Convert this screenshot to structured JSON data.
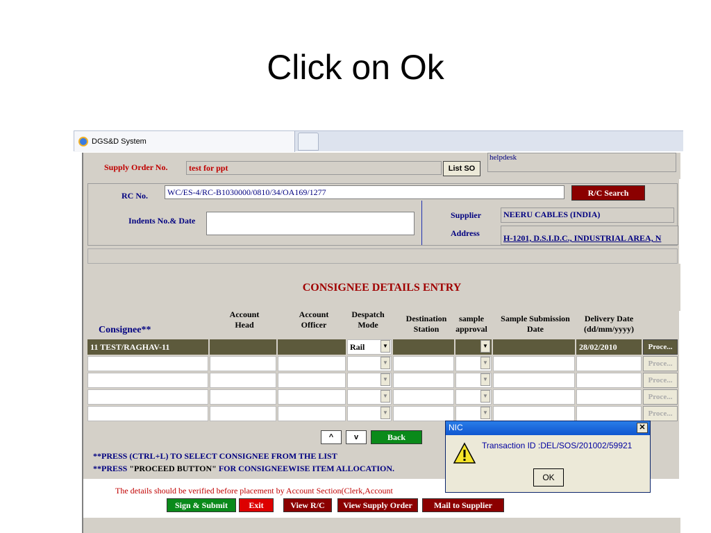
{
  "slide": {
    "title": "Click on Ok"
  },
  "browser": {
    "tab_title": "DGS&D System"
  },
  "top": {
    "supply_order_label": "Supply Order No.",
    "supply_order_value": "test for ppt",
    "list_so_button": "List SO",
    "helpdesk": "helpdesk"
  },
  "rc": {
    "rc_label": "RC No.",
    "rc_value": "WC/ES-4/RC-B1030000/0810/34/OA169/1277",
    "rc_search_button": "R/C Search",
    "indents_label": "Indents No.& Date",
    "indents_value": "",
    "supplier_label": "Supplier",
    "supplier_value": "NEERU CABLES (INDIA)",
    "address_label": "Address",
    "address_value": "H-1201, D.S.I.D.C., INDUSTRIAL AREA, N"
  },
  "section": {
    "heading": "CONSIGNEE DETAILS ENTRY"
  },
  "grid": {
    "headers": {
      "consignee": "Consignee**",
      "account_head_1": "Account",
      "account_head_2": "Head",
      "account_officer_1": "Account",
      "account_officer_2": "Officer",
      "despatch_1": "Despatch",
      "despatch_2": "Mode",
      "destination_1": "Destination",
      "destination_2": "Station",
      "sample_1": "sample",
      "sample_2": "approval",
      "submission_1": "Sample Submission",
      "submission_2": "Date",
      "delivery_1": "Delivery Date",
      "delivery_2": "(dd/mm/yyyy)"
    },
    "rows": [
      {
        "consignee": "11    TEST/RAGHAV-11",
        "despatch": "Rail",
        "delivery": "28/02/2010",
        "proceed": "Proce..."
      },
      {
        "consignee": "",
        "despatch": "",
        "delivery": "",
        "proceed": "Proce..."
      },
      {
        "consignee": "",
        "despatch": "",
        "delivery": "",
        "proceed": "Proce..."
      },
      {
        "consignee": "",
        "despatch": "",
        "delivery": "",
        "proceed": "Proce..."
      },
      {
        "consignee": "",
        "despatch": "",
        "delivery": "",
        "proceed": "Proce..."
      }
    ]
  },
  "nav": {
    "up": "^",
    "down": "v",
    "back": "Back"
  },
  "notes": {
    "line1": "**PRESS (CTRL+L) TO SELECT CONSIGNEE FROM THE LIST",
    "line2_a": "**PRESS ",
    "line2_b": "\"PROCEED BUTTON\"",
    "line2_c": " FOR CONSIGNEEWISE ITEM ALLOCATION.",
    "verify": "The details should be verified before placement by Account Section(Clerk,Account"
  },
  "actions": {
    "sign_submit": "Sign & Submit",
    "exit": "Exit",
    "view_rc": "View R/C",
    "view_supply_order": "View Supply Order",
    "mail_supplier": "Mail to Supplier"
  },
  "dialog": {
    "title": "NIC",
    "message": "Transaction ID :DEL/SOS/201002/59921",
    "ok": "OK"
  },
  "colors": {
    "accent_red": "#c00000",
    "navy": "#000080",
    "selected_row": "#5d5a3c",
    "green_button": "#0a8a1a",
    "maroon_button": "#8b0000"
  }
}
